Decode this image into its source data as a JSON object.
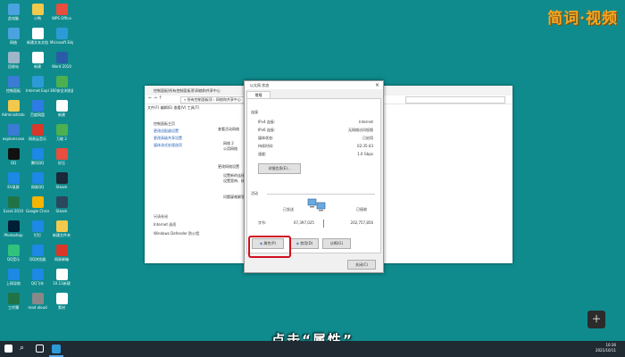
{
  "watermark": "简词·视频",
  "subtitle": "点击“属性”",
  "desktop": {
    "icons": [
      {
        "label": "此电脑",
        "color": "#4aa3df"
      },
      {
        "label": "小鸭",
        "color": "#f2c94c"
      },
      {
        "label": "WPS Office",
        "color": "#e84d3d"
      },
      {
        "label": "网络",
        "color": "#4aa3df"
      },
      {
        "label": "新建文本文档",
        "color": "#ffffff"
      },
      {
        "label": "Microsoft Edge",
        "color": "#2d9ad8"
      },
      {
        "label": "回收站",
        "color": "#9fb6c9"
      },
      {
        "label": "新建",
        "color": "#ffffff"
      },
      {
        "label": "Word 2010",
        "color": "#2a5ba8"
      },
      {
        "label": "控制面板",
        "color": "#3a7bd5"
      },
      {
        "label": "Internet Explorer",
        "color": "#2d9ad8"
      },
      {
        "label": "360安全浏览器",
        "color": "#4cb050"
      },
      {
        "label": "Administrator",
        "color": "#f2c94c"
      },
      {
        "label": "百度网盘",
        "color": "#2d7be5"
      },
      {
        "label": "新建",
        "color": "#ffffff"
      },
      {
        "label": "explorer.exe",
        "color": "#3a7bd5"
      },
      {
        "label": "网易云音乐",
        "color": "#d8372a"
      },
      {
        "label": "万能 2",
        "color": "#4cb050"
      },
      {
        "label": "QQ",
        "color": "#111111"
      },
      {
        "label": "腾讯QQ",
        "color": "#1e88e5"
      },
      {
        "label": "好压",
        "color": "#e84d3d"
      },
      {
        "label": "EV录屏",
        "color": "#1e88e5"
      },
      {
        "label": "网易QQ",
        "color": "#1e88e5"
      },
      {
        "label": "Steam",
        "color": "#1b2838"
      },
      {
        "label": "Excel 2010",
        "color": "#217346"
      },
      {
        "label": "Google Chrome",
        "color": "#f4b400"
      },
      {
        "label": "Steam",
        "color": "#2a475e"
      },
      {
        "label": "Photoshop",
        "color": "#001e36"
      },
      {
        "label": "钉钉",
        "color": "#1e88e5"
      },
      {
        "label": "新建文件夹",
        "color": "#f2c94c"
      },
      {
        "label": "QQ音乐",
        "color": "#31c27c"
      },
      {
        "label": "QQ浏览器",
        "color": "#1e88e5"
      },
      {
        "label": "网易邮箱",
        "color": "#d8372a"
      },
      {
        "label": "上网导航",
        "color": "#1e88e5"
      },
      {
        "label": "QQ飞车",
        "color": "#1e88e5"
      },
      {
        "label": "10.11新建",
        "color": "#ffffff"
      },
      {
        "label": "工作簿",
        "color": "#217346"
      },
      {
        "label": "read aloud",
        "color": "#888888"
      },
      {
        "label": "素材",
        "color": "#ffffff"
      }
    ]
  },
  "window": {
    "title": "控制面板\\所有控制面板项\\网络和共享中心",
    "address": "« 所有控制面板项 › 网络和共享中心",
    "menu": "文件(F)   编辑(E)   查看(V)   工具(T)",
    "left_links": [
      "控制面板主页",
      "更改适配器设置",
      "更改高级共享设置",
      "媒体流式处理选项"
    ],
    "see_also_title": "另请参阅",
    "see_also": [
      "Internet 选项",
      "Windows Defender 防火墙"
    ],
    "mid": [
      "查看活动网络",
      "网络 2",
      "公用网络",
      "更改网络设置",
      "设置新的连接或网络",
      "设置宽带、拨号或 VPN 连接",
      "问题疑难解答"
    ]
  },
  "dialog": {
    "title": "以太网 状态",
    "close": "×",
    "tab": "常规",
    "connection_label": "连接",
    "rows": [
      {
        "label": "IPv4 连接:",
        "value": "Internet"
      },
      {
        "label": "IPv6 连接:",
        "value": "无网络访问权限"
      },
      {
        "label": "媒体状态:",
        "value": "已启用"
      },
      {
        "label": "持续时间:",
        "value": "02:35:43"
      },
      {
        "label": "速度:",
        "value": "1.0 Gbps"
      }
    ],
    "details_btn": "详细信息(E)...",
    "activity_label": "活动",
    "sent_label": "已发送",
    "recv_label": "已接收",
    "bytes_label": "字节:",
    "bytes_sent": "67,397,025",
    "bytes_recv": "202,757,856",
    "properties_btn": "属性(P)",
    "disable_btn": "禁用(D)",
    "diagnose_btn": "诊断(G)",
    "close_btn": "关闭(C)"
  },
  "taskbar": {
    "time": "10:36",
    "date": "2021/10/11"
  },
  "new_note_icon": "add-note-icon"
}
